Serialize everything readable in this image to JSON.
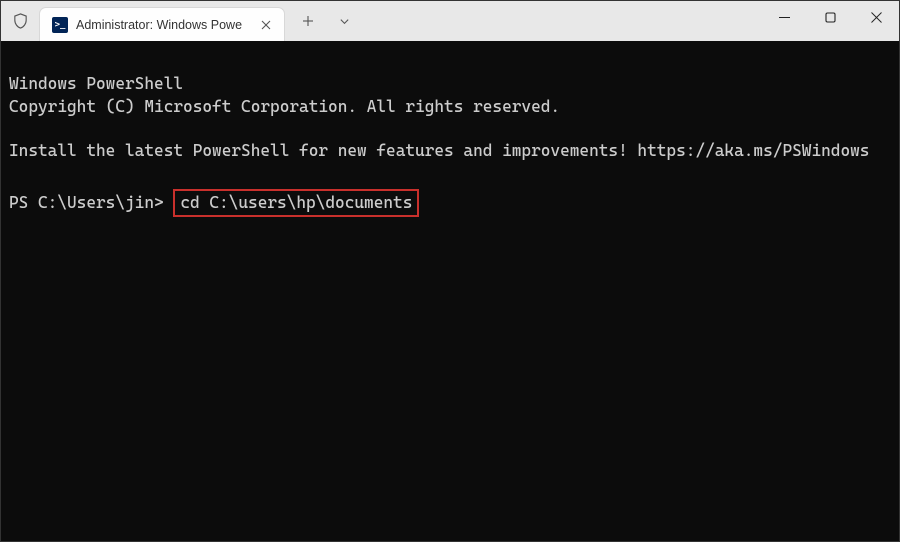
{
  "window": {
    "tab_title": "Administrator: Windows Powe"
  },
  "terminal": {
    "line1": "Windows PowerShell",
    "line2": "Copyright (C) Microsoft Corporation. All rights reserved.",
    "line3": "Install the latest PowerShell for new features and improvements! https://aka.ms/PSWindows",
    "prompt": "PS C:\\Users\\jin>",
    "command": "cd C:\\users\\hp\\documents"
  }
}
